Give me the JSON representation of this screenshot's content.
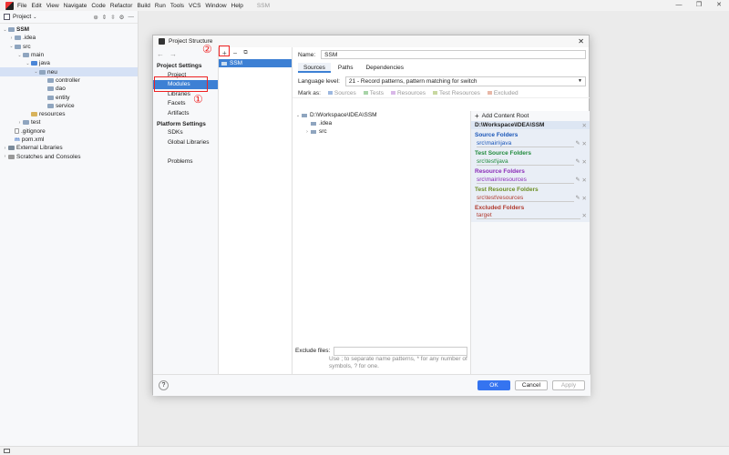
{
  "menubar": {
    "items": [
      "File",
      "Edit",
      "View",
      "Navigate",
      "Code",
      "Refactor",
      "Build",
      "Run",
      "Tools",
      "VCS",
      "Window",
      "Help"
    ],
    "title": "SSM"
  },
  "project_panel": {
    "title": "Project",
    "tree": [
      {
        "label": "SSM",
        "arrow": "⌄"
      },
      {
        "label": ".idea",
        "arrow": "›"
      },
      {
        "label": "src",
        "arrow": "⌄"
      },
      {
        "label": "main",
        "arrow": "⌄"
      },
      {
        "label": "java",
        "arrow": "⌄"
      },
      {
        "label": "neu",
        "arrow": "⌄"
      },
      {
        "label": "controller",
        "arrow": ""
      },
      {
        "label": "dao",
        "arrow": ""
      },
      {
        "label": "entity",
        "arrow": ""
      },
      {
        "label": "service",
        "arrow": ""
      },
      {
        "label": "resources",
        "arrow": ""
      },
      {
        "label": "test",
        "arrow": "›"
      },
      {
        "label": ".gitignore",
        "arrow": ""
      },
      {
        "label": "pom.xml",
        "arrow": ""
      },
      {
        "label": "External Libraries",
        "arrow": "›"
      },
      {
        "label": "Scratches and Consoles",
        "arrow": "›"
      }
    ]
  },
  "dialog": {
    "title": "Project Structure",
    "nav": {
      "project_settings": "Project Settings",
      "project_items": [
        "Project",
        "Modules",
        "Libraries",
        "Facets",
        "Artifacts"
      ],
      "platform_settings": "Platform Settings",
      "platform_items": [
        "SDKs",
        "Global Libraries"
      ],
      "problems": "Problems"
    },
    "modules": {
      "add": "+",
      "remove": "−",
      "copy": "⧉",
      "items": [
        "SSM"
      ]
    },
    "name_label": "Name:",
    "name_value": "SSM",
    "tabs": [
      "Sources",
      "Paths",
      "Dependencies"
    ],
    "language_level_label": "Language level:",
    "language_level_value": "21 - Record patterns, pattern matching for switch",
    "mark_as_label": "Mark as:",
    "mark_as_options": [
      "Sources",
      "Tests",
      "Resources",
      "Test Resources",
      "Excluded"
    ],
    "roots_tree": [
      {
        "label": "D:\\Workspace\\IDEA\\SSM",
        "arrow": "⌄"
      },
      {
        "label": ".idea",
        "arrow": ""
      },
      {
        "label": "src",
        "arrow": "›"
      }
    ],
    "content_root": {
      "add_label": "Add Content Root",
      "path": "D:\\Workspace\\IDEA\\SSM",
      "sections": [
        {
          "title": "Source Folders",
          "color": "#1a56b8",
          "entry": "src\\main\\java"
        },
        {
          "title": "Test Source Folders",
          "color": "#208a3c",
          "entry": "src\\test\\java"
        },
        {
          "title": "Resource Folders",
          "color": "#8a2bb8",
          "entry": "src\\main\\resources"
        },
        {
          "title": "Test Resource Folders",
          "color": "#6b8e23",
          "entry": "src\\test\\resources"
        },
        {
          "title": "Excluded Folders",
          "color": "#b03a2e",
          "entry": "target"
        }
      ]
    },
    "exclude_label": "Exclude files:",
    "exclude_hint": "Use ; to separate name patterns, * for any number of symbols, ? for one.",
    "buttons": {
      "help": "?",
      "ok": "OK",
      "cancel": "Cancel",
      "apply": "Apply"
    }
  },
  "annotations": [
    "①",
    "②"
  ]
}
